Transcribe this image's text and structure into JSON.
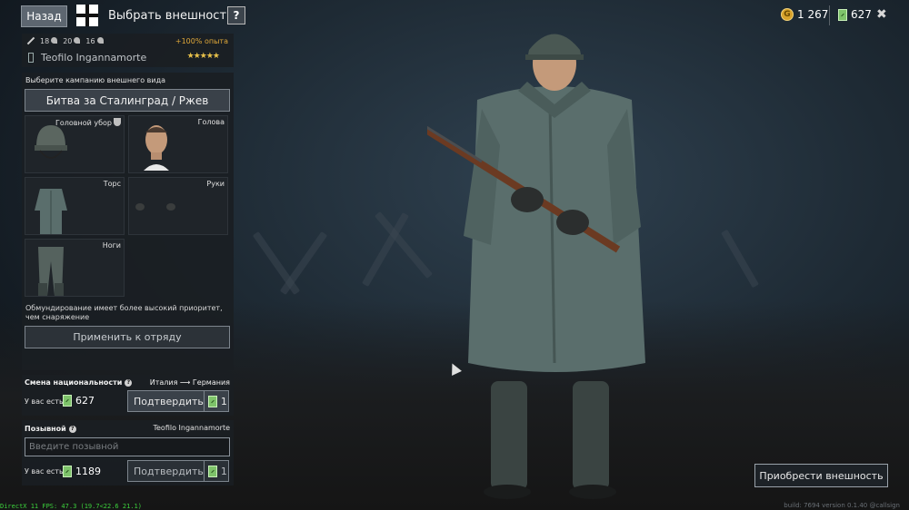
{
  "topbar": {
    "back_label": "Назад",
    "title": "Выбрать внешность",
    "help_label": "?",
    "gold_symbol": "G",
    "gold_amount": "1 267",
    "tickets_amount": "627",
    "close_label": "✖"
  },
  "soldier": {
    "stat1": "18",
    "stat2": "20",
    "stat3": "16",
    "xp_bonus": "+100% опыта",
    "name": "Teofilo Ingannamorte",
    "stars": "★★★★★"
  },
  "appearance": {
    "campaign_label": "Выберите кампанию внешнего вида",
    "campaign_value": "Битва за Сталинград / Ржев",
    "slots": {
      "headgear": "Головной убор",
      "head": "Голова",
      "torso": "Торс",
      "hands": "Руки",
      "legs": "Ноги"
    },
    "note": "Обмундирование имеет более высокий приоритет, чем снаряжение",
    "apply_label": "Применить к отряду"
  },
  "nationality": {
    "title": "Смена национальности",
    "change": "Италия ⟶ Германия",
    "have_label": "У вас есть",
    "have_amount": "627",
    "confirm_label": "Подтвердить",
    "price": "1"
  },
  "callsign": {
    "title": "Позывной",
    "current": "Teofilo Ingannamorte",
    "placeholder": "Введите позывной",
    "have_label": "У вас есть",
    "have_amount": "1189",
    "confirm_label": "Подтвердить",
    "price": "1"
  },
  "buy_label": "Приобрести внешность",
  "debug": "DirectX 11 FPS: 47.3 (19.7<22.6 21.1)",
  "build": "build: 7694 version 0.1.40 @callsign"
}
